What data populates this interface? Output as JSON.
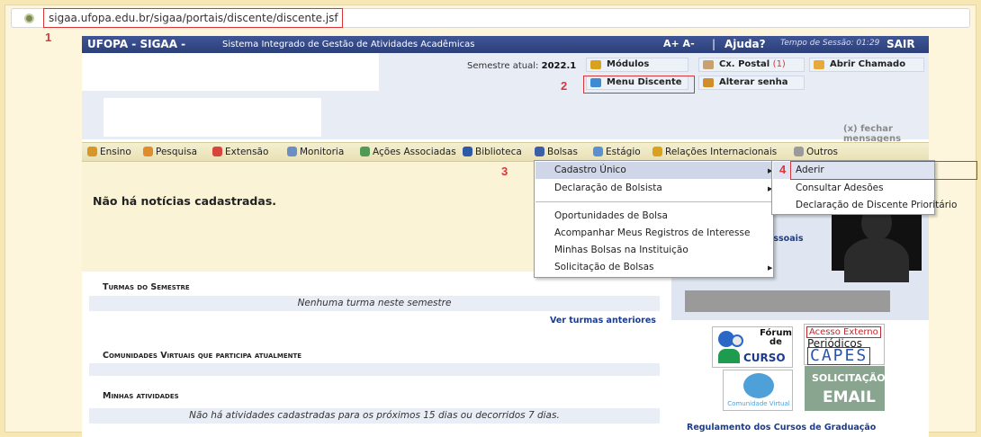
{
  "browser": {
    "url": "sigaa.ufopa.edu.br/sigaa/portais/discente/discente.jsf"
  },
  "annotations": {
    "n1": "1",
    "n2": "2",
    "n3": "3",
    "n4": "4"
  },
  "header": {
    "brand": "UFOPA - SIGAA -",
    "subtitle": "Sistema Integrado de Gestão de Atividades Acadêmicas",
    "font_controls": "A+ A-",
    "separator": "|",
    "help": "Ajuda?",
    "session": "Tempo de Sessão: 01:29",
    "logout": "SAIR"
  },
  "info": {
    "semester_label": "Semestre atual:",
    "semester_value": "2022.1",
    "buttons": {
      "modulos": "Módulos",
      "cx_postal": "Cx. Postal",
      "cx_postal_count": "(1)",
      "abrir_chamado": "Abrir Chamado",
      "menu_discente": "Menu Discente",
      "alterar_senha": "Alterar senha"
    },
    "close_messages": "(x) fechar mensagens"
  },
  "menu": {
    "ensino": "Ensino",
    "pesquisa": "Pesquisa",
    "extensao": "Extensão",
    "monitoria": "Monitoria",
    "acoes": "Ações Associadas",
    "biblioteca": "Biblioteca",
    "bolsas": "Bolsas",
    "estagio": "Estágio",
    "relacoes": "Relações Internacionais",
    "outros": "Outros"
  },
  "dropdown": {
    "items": [
      "Cadastro Único",
      "Declaração de Bolsista",
      "Oportunidades de Bolsa",
      "Acompanhar Meus Registros de Interesse",
      "Minhas Bolsas na Instituição",
      "Solicitação de Bolsas"
    ],
    "arrow": "▶"
  },
  "submenu": {
    "items": [
      "Aderir",
      "Consultar Adesões",
      "Declaração de Discente Prioritário"
    ]
  },
  "main": {
    "news": "Não há notícias cadastradas.",
    "turmas_title": "Turmas do Semestre",
    "turmas_empty": "Nenhuma turma neste semestre",
    "turmas_link": "Ver turmas anteriores",
    "comunidades_title": "Comunidades Virtuais que participa atualmente",
    "atividades_title": "Minhas atividades",
    "atividades_empty": "Não há atividades cadastradas para os próximos 15 dias ou decorridos 7 dias."
  },
  "sidebar": {
    "dados_pessoais": "s Pessoais",
    "forum_title": "Fórum de",
    "forum_curso": "CURSO",
    "capes_acesso": "Acesso Externo",
    "capes_periodicos": "Periódicos",
    "capes_logo": "CAPES",
    "comunidade": "Comunidade Virtual",
    "solicitacao": "SOLICITAÇÃO",
    "email": "EMAIL",
    "regulamento": "Regulamento dos Cursos de Graduação"
  },
  "colors": {
    "annotation": "#d9363b",
    "header_bg": "#2b3f7a",
    "link": "#1a3d8f",
    "menu_bg": "#ece5bd"
  }
}
